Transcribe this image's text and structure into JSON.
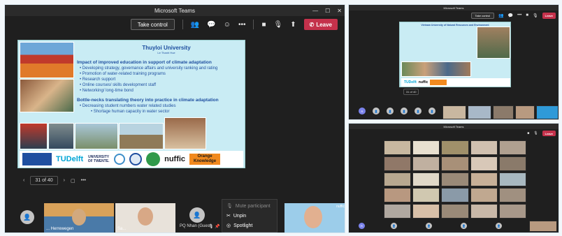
{
  "main": {
    "title": "Microsoft Teams",
    "take_control": "Take control",
    "leave": "Leave",
    "slide": {
      "title": "Thuyloi University",
      "subtitle": "Le Thanh Hue",
      "heading1": "Impact of improved education in support of climate adaptation",
      "bullets1": [
        "Developing strategy, governance affairs and university ranking and rating",
        "Promotion of water-related training programs",
        "Research support",
        "Online courses/ skills development staff",
        "Networking/ long-time bond"
      ],
      "heading2": "Bottle-necks translating theory into practice in climate adaptation",
      "bullets2": [
        "Decreasing student numbers water related studies",
        "Shortage human capacity in water sector"
      ],
      "logos": [
        "TUDelft",
        "UNIVERSITY OF TWENTE.",
        "nuffic",
        "Orange Knowledge"
      ]
    },
    "pager": "31 of 40",
    "menu": [
      "Mute participant",
      "Unpin",
      "Spotlight"
    ],
    "participants": [
      {
        "name": "... Herrewegen"
      },
      {
        "name": "Sa..."
      },
      {
        "name": "PQ Nhan (Guest)"
      },
      {
        "name": ""
      }
    ]
  },
  "top_right": {
    "title": "Microsoft Teams",
    "take_control": "Take control",
    "leave": "Leave",
    "slide_title": "Vietnam University of Natural Resources and Environment",
    "pager": "31 of 40"
  },
  "bottom_right": {
    "title": "Microsoft Teams",
    "leave": "Leave"
  },
  "colors": {
    "leave": "#c4314b",
    "slide_bg": "#c9ecf4",
    "slide_text": "#1f4fa0"
  }
}
